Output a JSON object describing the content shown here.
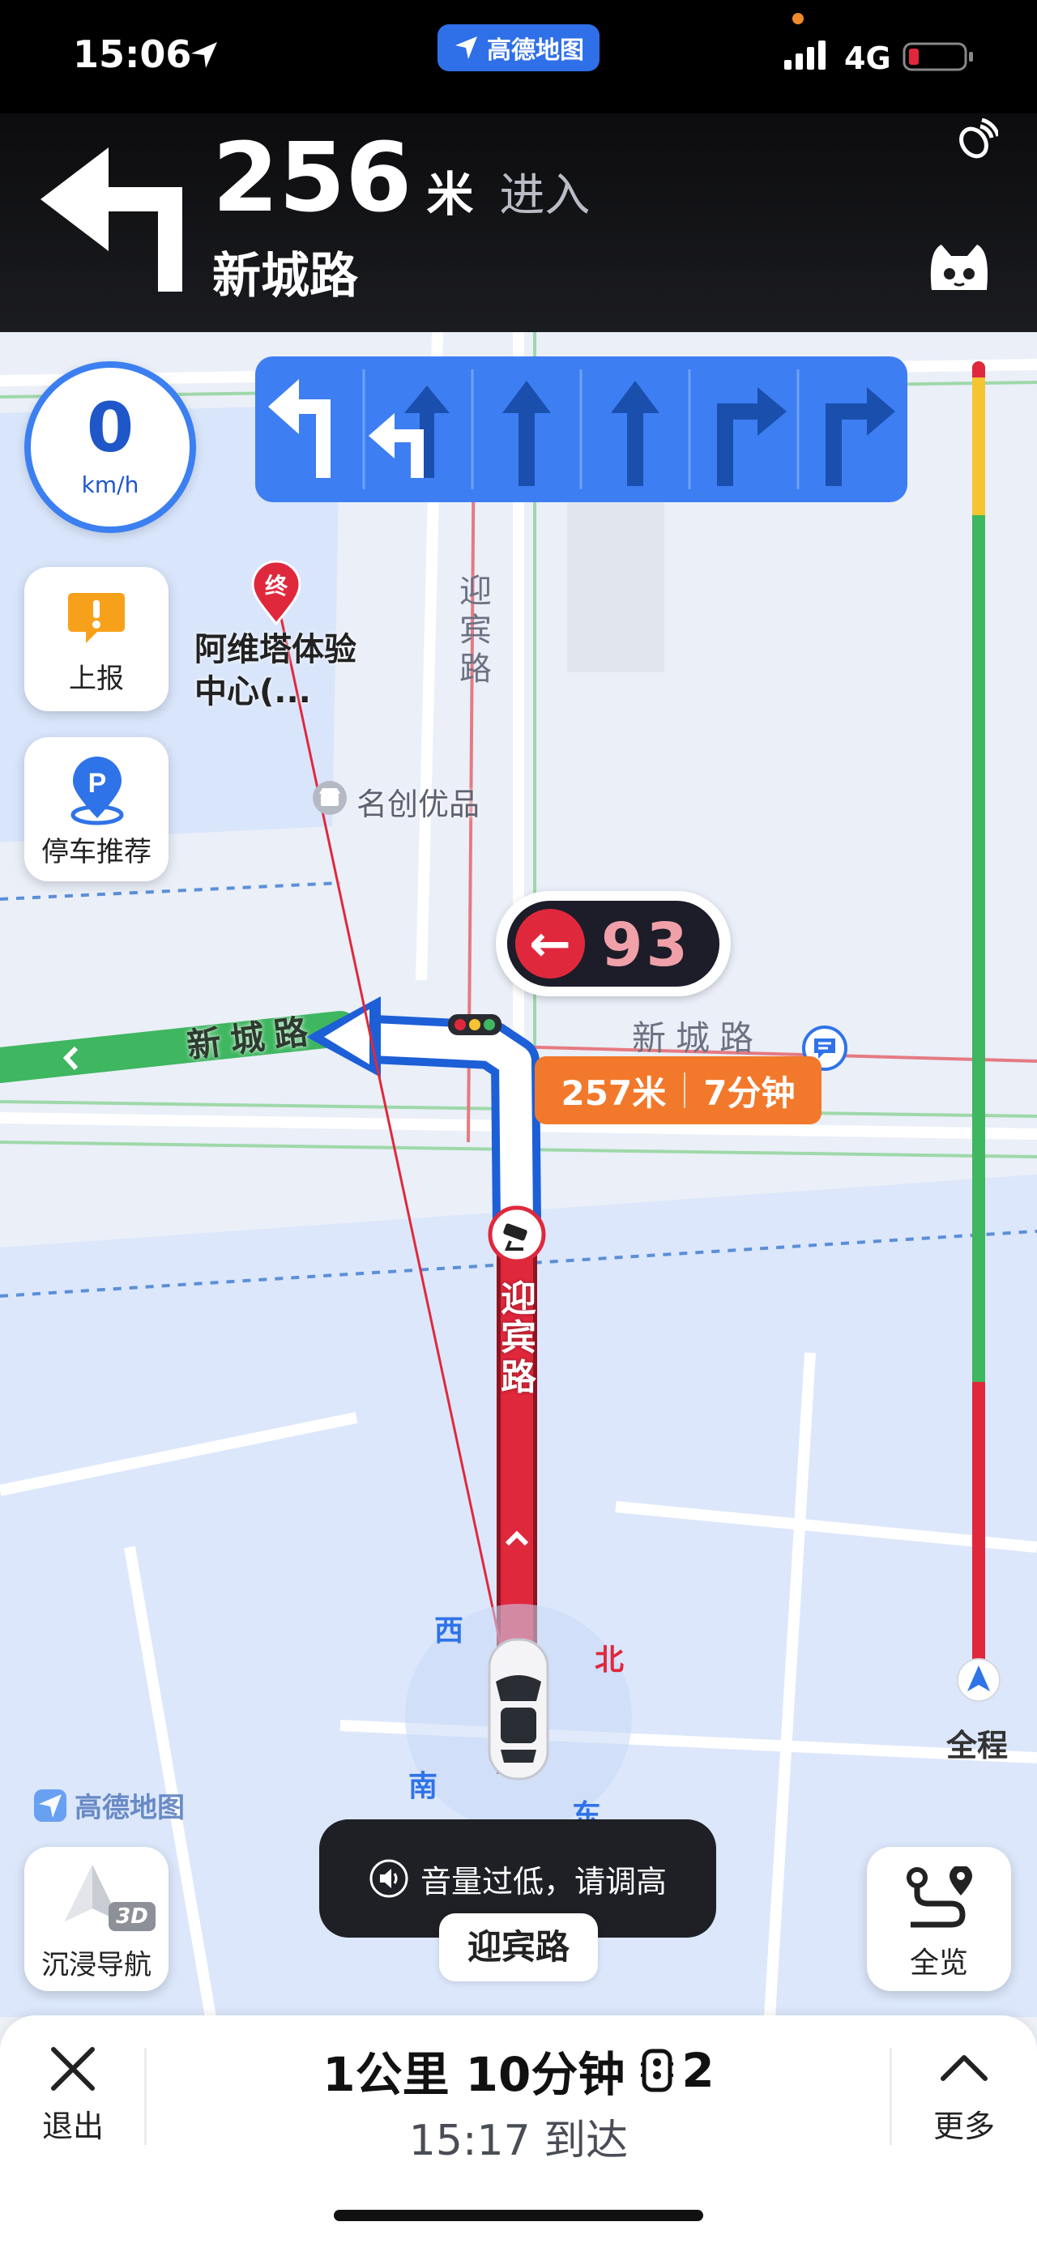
{
  "status": {
    "time": "15:06",
    "app_badge": "高德地图",
    "network": "4G"
  },
  "nav": {
    "distance": "256",
    "unit": "米",
    "action": "进入",
    "road": "新城路"
  },
  "speed": {
    "value": "0",
    "unit": "km/h"
  },
  "side_buttons": {
    "report": "上报",
    "parking": "停车推荐"
  },
  "map_labels": {
    "destination_marker": "终",
    "destination_name": "阿维塔体验中心(...",
    "poi_mingchuang": "名创优品",
    "road_yingbin_vertical": "迎宾路",
    "road_xincheng_left": "新城路",
    "road_xincheng_right": "新城路",
    "road_yingbin_route": "迎宾路",
    "compass": {
      "west": "西",
      "north": "北",
      "south": "南",
      "east": "东"
    },
    "watermark": "高德地图",
    "current_road": "迎宾路"
  },
  "traffic_light": {
    "countdown": "93",
    "direction": "←"
  },
  "route_tip": {
    "distance": "257米",
    "time": "7分钟"
  },
  "full_route": {
    "label": "全程"
  },
  "toast": {
    "message": "音量过低，请调高"
  },
  "immersive": {
    "label": "沉浸导航",
    "badge": "3D"
  },
  "overview": {
    "label": "全览"
  },
  "bottom": {
    "exit": "退出",
    "summary_distance": "1公里",
    "summary_time": "10分钟",
    "traffic_lights": "2",
    "arrival": "15:17 到达",
    "more": "更多"
  },
  "colors": {
    "lane_bg": "#3d7ef2",
    "route_red": "#e0283d",
    "route_green": "#3fb660",
    "tip_orange": "#f2792b",
    "accent_blue": "#2f73e8"
  }
}
